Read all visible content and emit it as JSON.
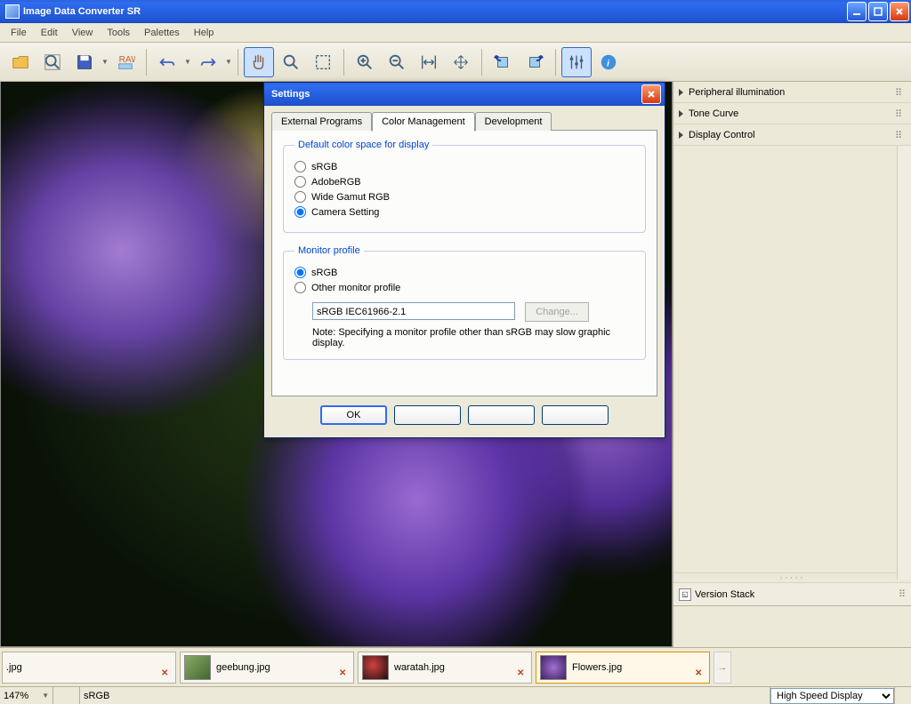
{
  "window": {
    "title": "Image Data Converter SR"
  },
  "menu": {
    "file": "File",
    "edit": "Edit",
    "view": "View",
    "tools": "Tools",
    "palettes": "Palettes",
    "help": "Help"
  },
  "side_panels": {
    "peripheral": "Peripheral illumination",
    "tone_curve": "Tone Curve",
    "display_control": "Display Control",
    "version_stack": "Version Stack"
  },
  "thumbs": {
    "t1": ".jpg",
    "t2": "geebung.jpg",
    "t3": "waratah.jpg",
    "t4": "Flowers.jpg"
  },
  "status": {
    "zoom": "147%",
    "colorspace": "sRGB",
    "display_mode": "High Speed Display"
  },
  "dialog": {
    "title": "Settings",
    "tabs": {
      "external": "External Programs",
      "color": "Color Management",
      "dev": "Development"
    },
    "group_default": "Default color space for display",
    "opt_srgb": "sRGB",
    "opt_adobe": "AdobeRGB",
    "opt_wide": "Wide Gamut RGB",
    "opt_camera": "Camera Setting",
    "group_monitor": "Monitor profile",
    "mon_srgb": "sRGB",
    "mon_other": "Other monitor profile",
    "profile_value": "sRGB IEC61966-2.1",
    "change_btn": "Change...",
    "note": "Note: Specifying a monitor profile other than sRGB may slow graphic display.",
    "ok": "OK"
  }
}
